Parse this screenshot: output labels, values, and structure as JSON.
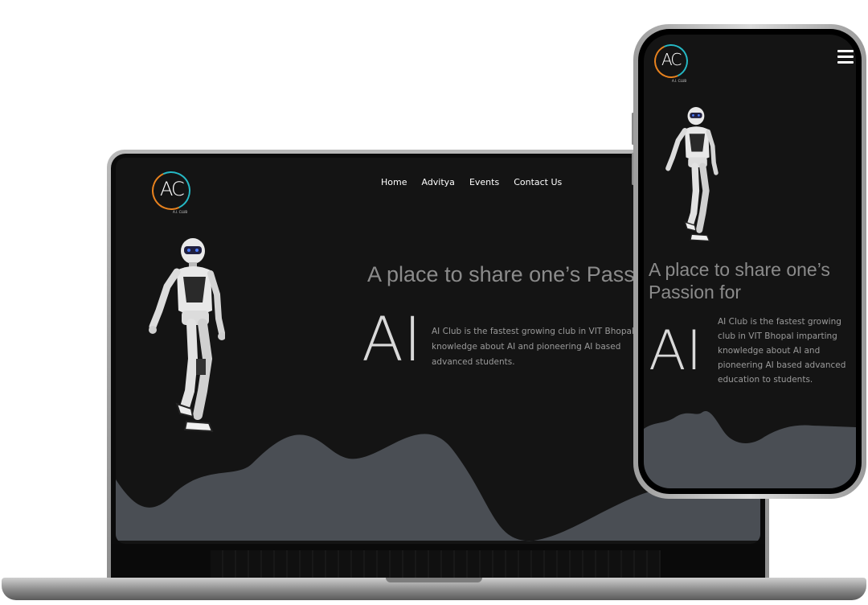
{
  "brand": {
    "logo_text": "AC",
    "logo_subtext": "A.I. CLUB",
    "accent_orange": "#e8821e",
    "accent_teal": "#25b8c4"
  },
  "nav": {
    "items": [
      "Home",
      "Advitya",
      "Events",
      "Contact Us"
    ]
  },
  "hero": {
    "title": "A place to share one’s Pass",
    "big_text": "AI",
    "description": "AI Club is the fastest growing club in VIT Bhopal in knowledge about AI and pioneering AI based advanced students."
  },
  "mobile": {
    "title_line1": "A place to share one’s",
    "title_line2": "Passion for",
    "big_text": "AI",
    "description": "AI Club is the fastest growing club in VIT Bhopal imparting knowledge about AI and pioneering AI based advanced education to students.",
    "menu_icon": "hamburger-menu-icon"
  },
  "colors": {
    "page_bg": "#141414",
    "wave": "#4a4e54",
    "text_gray": "#8b8b8b"
  }
}
